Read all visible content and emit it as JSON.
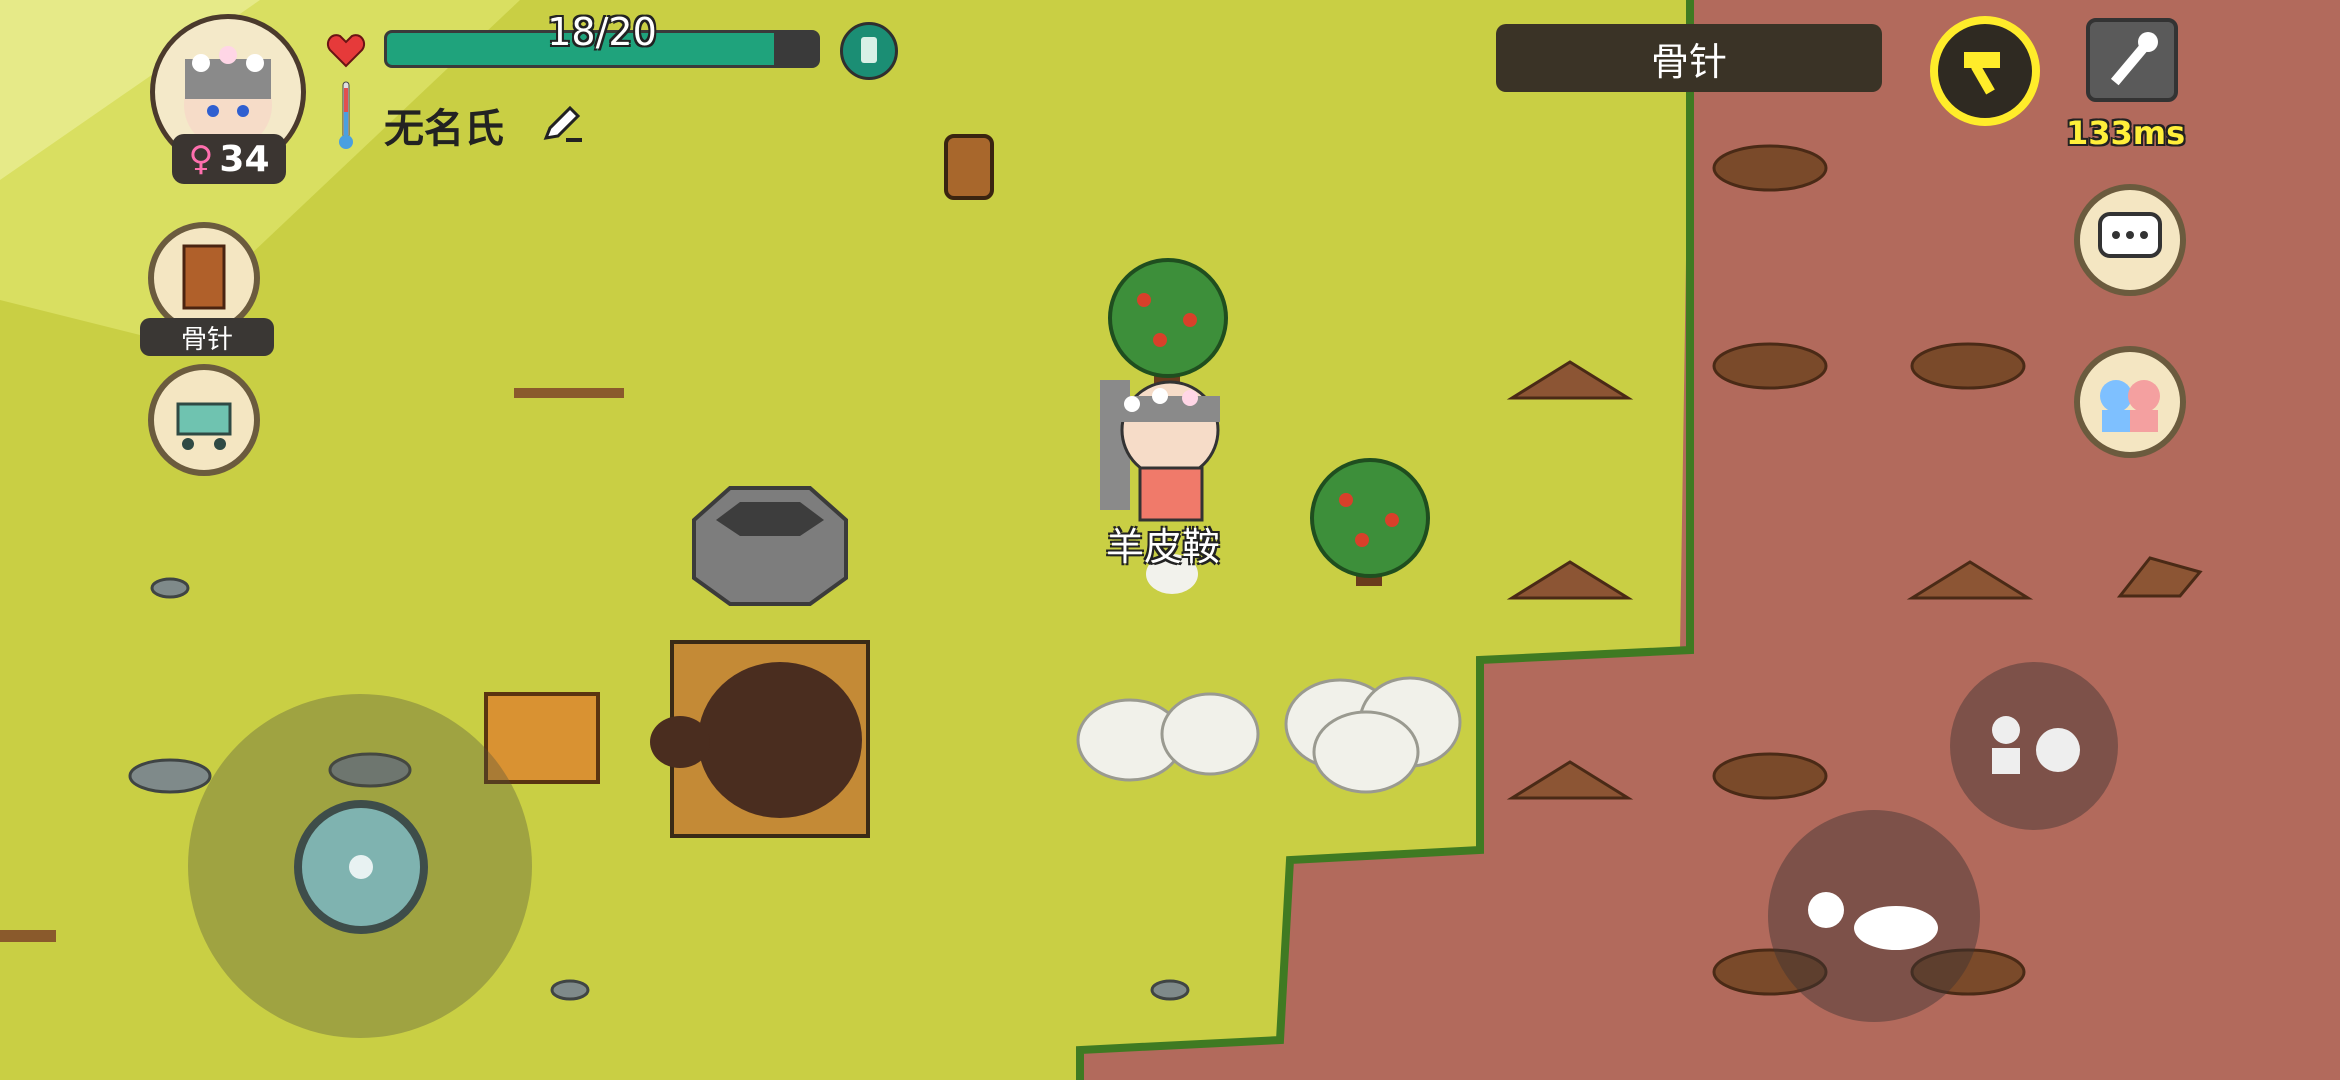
{
  "player": {
    "health_text": "18/20",
    "health_fraction": 0.9,
    "name": "无名氏",
    "age": "34",
    "gender_symbol": "♀"
  },
  "held_item": {
    "title": "骨针",
    "side_label": "骨针"
  },
  "network": {
    "ping": "133ms"
  },
  "world_labels": {
    "character_item": "羊皮鞍"
  },
  "colors": {
    "grass": "#c9cf44",
    "dirt": "#b26a5c",
    "health": "#1fa37c",
    "hammer_ring": "#ffec2a",
    "ping": "#ffef3a"
  },
  "icons": {
    "avatar": "player-avatar-icon",
    "heart": "heart-icon",
    "food": "food-jar-icon",
    "thermometer": "thermometer-icon",
    "edit_name": "pencil-icon",
    "tool": "bone-needle-tool-icon",
    "shop": "shop-cart-icon",
    "build": "hammer-icon",
    "settings": "wrench-icon",
    "chat": "chat-bubble-icon",
    "social": "friends-icon",
    "interact": "hand-interact-icon",
    "punch": "punch-icon"
  }
}
